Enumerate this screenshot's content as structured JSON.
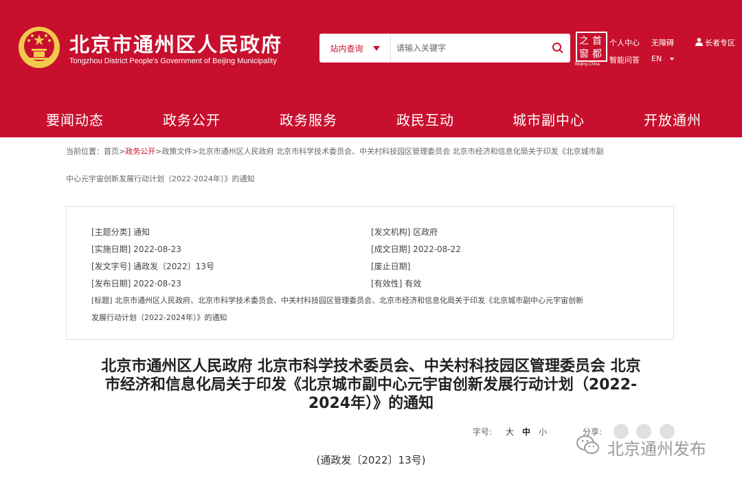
{
  "header": {
    "title": "北京市通州区人民政府",
    "subtitle": "Tongzhou District People's Government of Beijing Municipality",
    "search": {
      "scope": "站内查询",
      "placeholder": "请输入关键字"
    },
    "logo_chars": [
      "之",
      "首",
      "窗",
      "都"
    ],
    "logo_sub": "Beijing·China",
    "links": {
      "personal": "个人中心",
      "accessible": "无障碍",
      "qa": "智能问答",
      "lang": "EN",
      "elder": "长者专区"
    }
  },
  "nav": [
    "要闻动态",
    "政务公开",
    "政务服务",
    "政民互动",
    "城市副中心",
    "开放通州"
  ],
  "breadcrumb": {
    "label": "当前位置：",
    "home": "首页",
    "sep": ">",
    "open": "政务公开",
    "docs": "政策文件",
    "line1_tail": "北京市通州区人民政府 北京市科学技术委员会、中关村科技园区管理委员会 北京市经济和信息化局关于印发《北京城市副",
    "line2": "中心元宇宙创新发展行动计划（2022-2024年）》的通知"
  },
  "meta": {
    "topic": "[主题分类] 通知",
    "issuer": "[发文机构] 区政府",
    "effective": "[实施日期] 2022-08-23",
    "written": "[成文日期] 2022-08-22",
    "doc_no": "[发文字号] 通政发〔2022〕13号",
    "abolish": "[废止日期]",
    "published": "[发布日期] 2022-08-23",
    "validity": "[有效性] 有效",
    "title_line1": "[标题] 北京市通州区人民政府、北京市科学技术委员会、中关村科技园区管理委员会、北京市经济和信息化局关于印发《北京城市副中心元宇宙创新",
    "title_line2": "发展行动计划（2022-2024年）》的通知"
  },
  "article": {
    "title_line1": "北京市通州区人民政府 北京市科学技术委员会、中关村科技园区管理委员会 北京",
    "title_line2": "市经济和信息化局关于印发《北京城市副中心元宇宙创新发展行动计划（2022-",
    "title_line3": "2024年）》的通知",
    "font_label": "字号:",
    "font_large": "大",
    "font_medium": "中",
    "font_small": "小",
    "share_label": "分享:",
    "doc_number": "(通政发〔2022〕13号)"
  },
  "watermark": "北京通州发布",
  "colors": {
    "brand_red": "#c8102e",
    "gold": "#f2c94c"
  }
}
